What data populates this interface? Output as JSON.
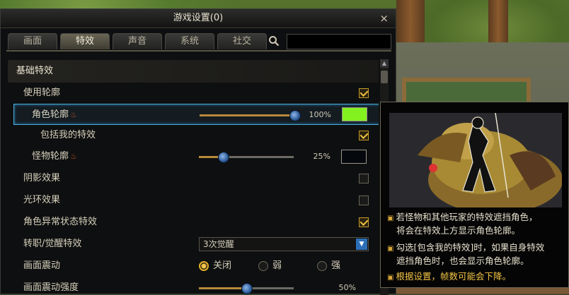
{
  "window": {
    "title": "游戏设置(0)",
    "close_glyph": "×"
  },
  "tabs": [
    {
      "label": "画面",
      "active": false
    },
    {
      "label": "特效",
      "active": true
    },
    {
      "label": "声音",
      "active": false
    },
    {
      "label": "系统",
      "active": false
    },
    {
      "label": "社交",
      "active": false
    }
  ],
  "search": {
    "value": "",
    "placeholder": ""
  },
  "settings": {
    "section_basic": "基础特效",
    "use_outline": {
      "label": "使用轮廓",
      "checked": true
    },
    "character_outline": {
      "label": "角色轮廓",
      "flame": "🔥",
      "slider_value": 1.0,
      "percent": "100%",
      "color": "#84f020"
    },
    "include_my_effects": {
      "label": "包括我的特效",
      "checked": true
    },
    "monster_outline": {
      "label": "怪物轮廓",
      "flame": "🔥",
      "slider_value": 0.25,
      "percent": "25%",
      "color": "#05080c"
    },
    "shadow_effect": {
      "label": "阴影效果",
      "checked": false
    },
    "halo_effect": {
      "label": "光环效果",
      "checked": false
    },
    "status_effect": {
      "label": "角色异常状态特效",
      "checked": true
    },
    "awakening": {
      "label": "转职/觉醒特效",
      "selected": "3次觉醒"
    },
    "screen_shake": {
      "label": "画面震动",
      "options": [
        "关闭",
        "弱",
        "强"
      ],
      "selected": "关闭"
    },
    "shake_strength": {
      "label": "画面震动强度",
      "slider_value": 0.5,
      "percent": "50%"
    }
  },
  "tooltip": {
    "lines": [
      {
        "text": "若怪物和其他玩家的特效遮挡角色，",
        "bullet": true
      },
      {
        "text": "将会在特效上方显示角色轮廓。",
        "bullet": false
      },
      {
        "text": "勾选[包含我的特效]时，如果自身特效",
        "bullet": true
      },
      {
        "text": "遮挡角色时，也会显示角色轮廓。",
        "bullet": false
      },
      {
        "text": "根据设置，帧数可能会下降。",
        "bullet": true
      }
    ]
  }
}
